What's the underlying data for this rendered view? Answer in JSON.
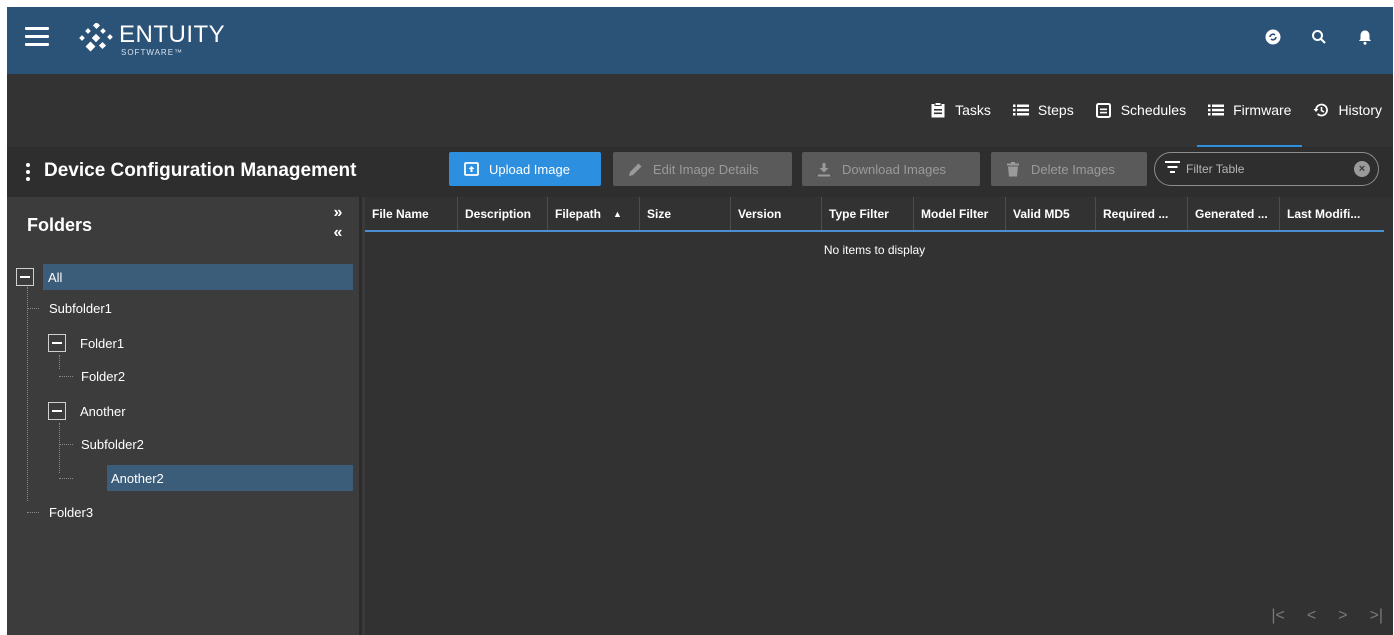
{
  "brand": {
    "name": "ENTUITY",
    "sub": "SOFTWARE™"
  },
  "tabs": [
    {
      "label": "Tasks",
      "icon": "clipboard-icon",
      "active": false
    },
    {
      "label": "Steps",
      "icon": "list-icon",
      "active": false
    },
    {
      "label": "Schedules",
      "icon": "calendar-icon",
      "active": false
    },
    {
      "label": "Firmware",
      "icon": "list-icon",
      "active": true
    },
    {
      "label": "History",
      "icon": "history-icon",
      "active": false
    }
  ],
  "toolbar": {
    "title": "Device Configuration Management",
    "upload_label": "Upload Image",
    "edit_label": "Edit Image Details",
    "download_label": "Download Images",
    "delete_label": "Delete Images",
    "filter_placeholder": "Filter Table"
  },
  "folders": {
    "title": "Folders",
    "nodes": [
      {
        "label": "All",
        "expanded": true,
        "selected": false
      },
      {
        "label": "Subfolder1"
      },
      {
        "label": "Folder1",
        "expanded": true
      },
      {
        "label": "Folder2"
      },
      {
        "label": "Another",
        "expanded": true
      },
      {
        "label": "Subfolder2"
      },
      {
        "label": "Another2",
        "selected": true
      },
      {
        "label": "Folder3"
      }
    ]
  },
  "table": {
    "columns": [
      "File Name",
      "Description",
      "Filepath",
      "Size",
      "Version",
      "Type Filter",
      "Model Filter",
      "Valid MD5",
      "Required ...",
      "Generated ...",
      "Last Modifi..."
    ],
    "sort_column": "Filepath",
    "empty_text": "No items to display",
    "pager": [
      "|<",
      "<",
      ">",
      ">|"
    ]
  },
  "colors": {
    "header": "#2b5277",
    "accent": "#2d8fe0",
    "selection": "#3c5d7a"
  }
}
